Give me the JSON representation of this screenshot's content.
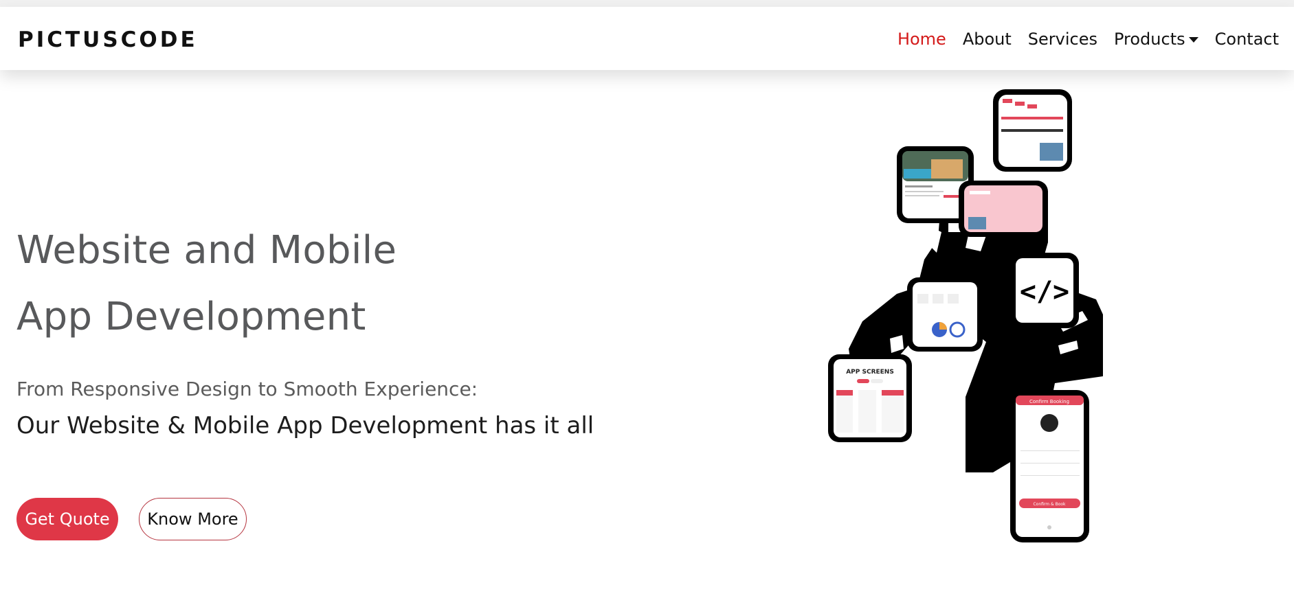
{
  "brand": {
    "logo_text": "PICTUSCODE"
  },
  "nav": {
    "items": [
      {
        "label": "Home",
        "active": true
      },
      {
        "label": "About",
        "active": false
      },
      {
        "label": "Services",
        "active": false
      },
      {
        "label": "Products",
        "active": false,
        "has_dropdown": true
      },
      {
        "label": "Contact",
        "active": false
      }
    ],
    "active_color": "#d41a1a"
  },
  "hero": {
    "title_line1": "Website and Mobile",
    "title_line2": "App Development",
    "subtitle": "From Responsive Design to Smooth Experience:",
    "tagline": "Our Website & Mobile App Development has it all",
    "primary_button": "Get Quote",
    "secondary_button": "Know More",
    "accent_color": "#df3747"
  },
  "illustration": {
    "app_screens_label": "APP SCREENS",
    "code_symbol": "</>",
    "booking_header": "Confirm Booking",
    "booking_button": "Confirm & Book"
  }
}
